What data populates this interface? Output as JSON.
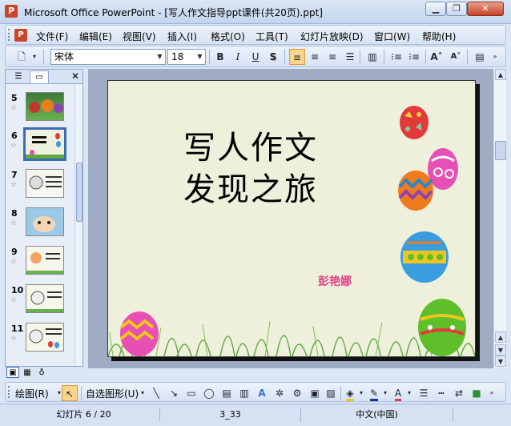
{
  "window": {
    "title": "Microsoft Office PowerPoint - [写人作文指导ppt课件(共20页).ppt]",
    "minimize_icon": "minimize-icon",
    "maximize_icon": "restore-icon",
    "close_icon": "close-icon"
  },
  "menu": {
    "items": [
      {
        "label": "文件(F)"
      },
      {
        "label": "编辑(E)"
      },
      {
        "label": "视图(V)"
      },
      {
        "label": "插入(I)"
      },
      {
        "label": "格式(O)"
      },
      {
        "label": "工具(T)"
      },
      {
        "label": "幻灯片放映(D)"
      },
      {
        "label": "窗口(W)"
      },
      {
        "label": "帮助(H)"
      }
    ]
  },
  "format_toolbar": {
    "font_name": "宋体",
    "font_size": "18",
    "bold": "B",
    "italic": "I",
    "underline": "U",
    "shadow": "S",
    "active_align": "align-left"
  },
  "slides_panel": {
    "current": 6,
    "thumbnails": [
      {
        "number": "5"
      },
      {
        "number": "6"
      },
      {
        "number": "7"
      },
      {
        "number": "8"
      },
      {
        "number": "9"
      },
      {
        "number": "10"
      },
      {
        "number": "11"
      }
    ]
  },
  "slide": {
    "title_line1": "写人作文",
    "title_line2": "发现之旅",
    "author": "彭艳娜",
    "background": "#eef0dc",
    "egg_colors": [
      "#e23a3a",
      "#e84fb4",
      "#f07b1e",
      "#3a9de0",
      "#5fbf2a",
      "#f0c61e"
    ]
  },
  "draw_toolbar": {
    "draw_label": "绘图(R)",
    "autoshapes_label": "自选图形(U)"
  },
  "status": {
    "slide_position": "幻灯片 6 / 20",
    "design": "3_33",
    "language": "中文(中国)"
  }
}
